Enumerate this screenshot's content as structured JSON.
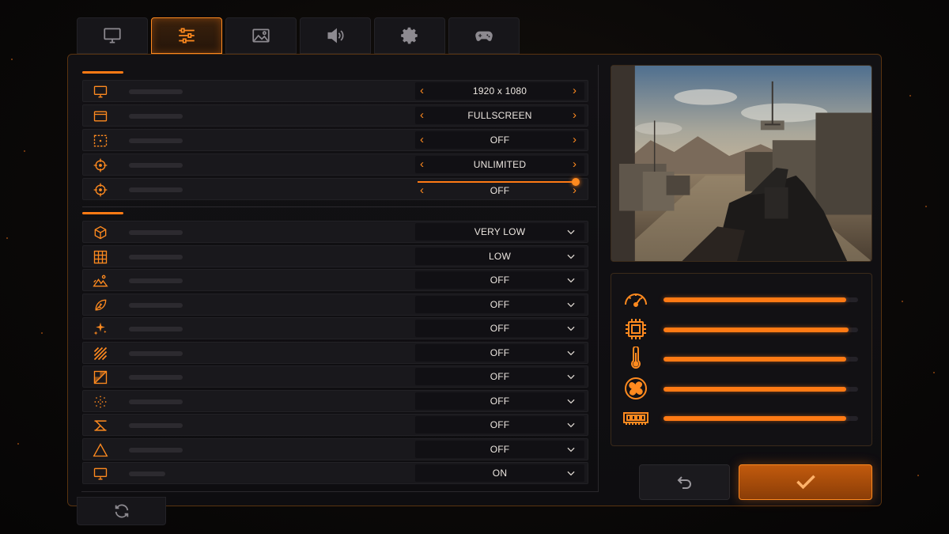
{
  "tabs": [
    {
      "id": "display",
      "icon": "monitor-icon",
      "active": false
    },
    {
      "id": "sliders",
      "icon": "sliders-icon",
      "active": true
    },
    {
      "id": "graphics",
      "icon": "image-icon",
      "active": false
    },
    {
      "id": "audio",
      "icon": "speaker-icon",
      "active": false
    },
    {
      "id": "general",
      "icon": "gear-icon",
      "active": false
    },
    {
      "id": "controls",
      "icon": "gamepad-icon",
      "active": false
    }
  ],
  "display_settings": [
    {
      "icon": "monitor-icon",
      "control": "arrows",
      "value": "1920 x 1080"
    },
    {
      "icon": "window-icon",
      "control": "arrows",
      "value": "FULLSCREEN"
    },
    {
      "icon": "frame-select-icon",
      "control": "arrows",
      "value": "OFF"
    },
    {
      "icon": "crosshair-icon",
      "control": "arrows",
      "value": "UNLIMITED"
    },
    {
      "icon": "crosshair-icon",
      "control": "slider",
      "value": "OFF",
      "slider_level": 1.0
    }
  ],
  "graphics_settings": [
    {
      "icon": "cube-icon",
      "value": "VERY LOW"
    },
    {
      "icon": "grid-icon",
      "value": "LOW"
    },
    {
      "icon": "landscape-icon",
      "value": "OFF"
    },
    {
      "icon": "leaf-icon",
      "value": "OFF"
    },
    {
      "icon": "sparkle-icon",
      "value": "OFF"
    },
    {
      "icon": "stripes-icon",
      "value": "OFF"
    },
    {
      "icon": "shadow-icon",
      "value": "OFF"
    },
    {
      "icon": "dots-circle-icon",
      "value": "OFF"
    },
    {
      "icon": "strike-icon",
      "value": "OFF"
    },
    {
      "icon": "triangle-icon",
      "value": "OFF"
    },
    {
      "icon": "monitor-icon",
      "value": "ON"
    }
  ],
  "stats": [
    {
      "icon": "speedometer-icon",
      "level": 0.94
    },
    {
      "icon": "cpu-icon",
      "level": 0.95
    },
    {
      "icon": "thermometer-icon",
      "level": 0.94
    },
    {
      "icon": "fan-icon",
      "level": 0.94
    },
    {
      "icon": "memory-icon",
      "level": 0.94
    }
  ],
  "buttons": {
    "back": "undo-icon",
    "confirm": "check-icon",
    "reset": "refresh-icon"
  },
  "colors": {
    "accent": "#ff7a14",
    "background": "#0b0908",
    "panel": "#19181c"
  }
}
